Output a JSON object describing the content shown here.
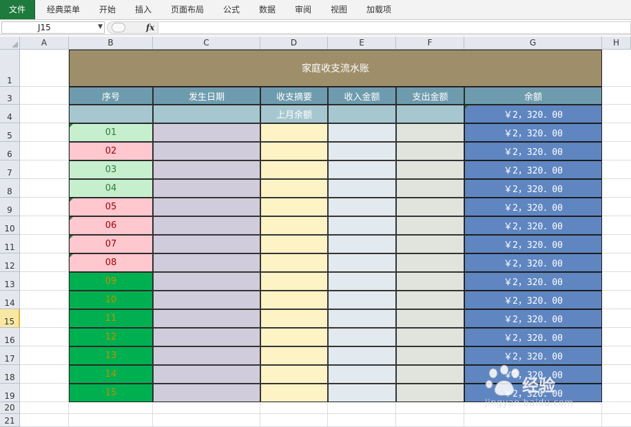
{
  "ribbon": {
    "file_tab": "文件",
    "tabs": [
      "经典菜单",
      "开始",
      "插入",
      "页面布局",
      "公式",
      "数据",
      "审阅",
      "视图",
      "加载项"
    ]
  },
  "formula_bar": {
    "name_box": "J15",
    "fx_label": "fx",
    "formula": ""
  },
  "columns": [
    "A",
    "B",
    "C",
    "D",
    "E",
    "F",
    "G",
    "H"
  ],
  "rows": [
    "1",
    "3",
    "4",
    "5",
    "6",
    "7",
    "8",
    "9",
    "10",
    "11",
    "12",
    "13",
    "14",
    "15",
    "16",
    "17",
    "18",
    "19",
    "20",
    "21"
  ],
  "active_row": "15",
  "sheet": {
    "title": "家庭收支流水账",
    "headers": [
      "序号",
      "发生日期",
      "收支摘要",
      "收入金额",
      "支出金额",
      "余额"
    ],
    "row4": {
      "summary": "上月余额",
      "balance": "￥2，320．00"
    },
    "entries": [
      {
        "no": "01",
        "balance": "￥2，320．00"
      },
      {
        "no": "02",
        "balance": "￥2，320．00"
      },
      {
        "no": "03",
        "balance": "￥2，320．00"
      },
      {
        "no": "04",
        "balance": "￥2，320．00"
      },
      {
        "no": "05",
        "balance": "￥2，320．00"
      },
      {
        "no": "06",
        "balance": "￥2，320．00"
      },
      {
        "no": "07",
        "balance": "￥2，320．00"
      },
      {
        "no": "08",
        "balance": "￥2，320．00"
      },
      {
        "no": "09",
        "balance": "￥2，320．00"
      },
      {
        "no": "10",
        "balance": "￥2，320．00"
      },
      {
        "no": "11",
        "balance": "￥2，320．00"
      },
      {
        "no": "12",
        "balance": "￥2，320．00"
      },
      {
        "no": "13",
        "balance": "￥2，320．00"
      },
      {
        "no": "14",
        "balance": "￥2，320．00"
      },
      {
        "no": "15",
        "balance": "￥2，320．00"
      }
    ]
  },
  "watermark": {
    "brand": "经验",
    "url": "jingyan.baidu.com"
  },
  "colors": {
    "file_tab": "#1e7a3d",
    "title_fill": "#9e8e6a",
    "header_fill": "#6e9cae",
    "balance_fill": "#5f86c1",
    "seq_green_light": "#c6efce",
    "seq_red_light": "#ffc7ce",
    "seq_green_dark": "#00b050",
    "seq_text_green": "#2f7a3a",
    "seq_text_red": "#9c0006",
    "seq_text_gold": "#c09000"
  },
  "seq_styles": [
    "light-green",
    "light-red",
    "light-green",
    "light-green",
    "light-red",
    "light-red",
    "light-red",
    "light-red",
    "dark-green",
    "dark-green",
    "dark-green",
    "dark-green",
    "dark-green",
    "dark-green",
    "dark-green"
  ]
}
